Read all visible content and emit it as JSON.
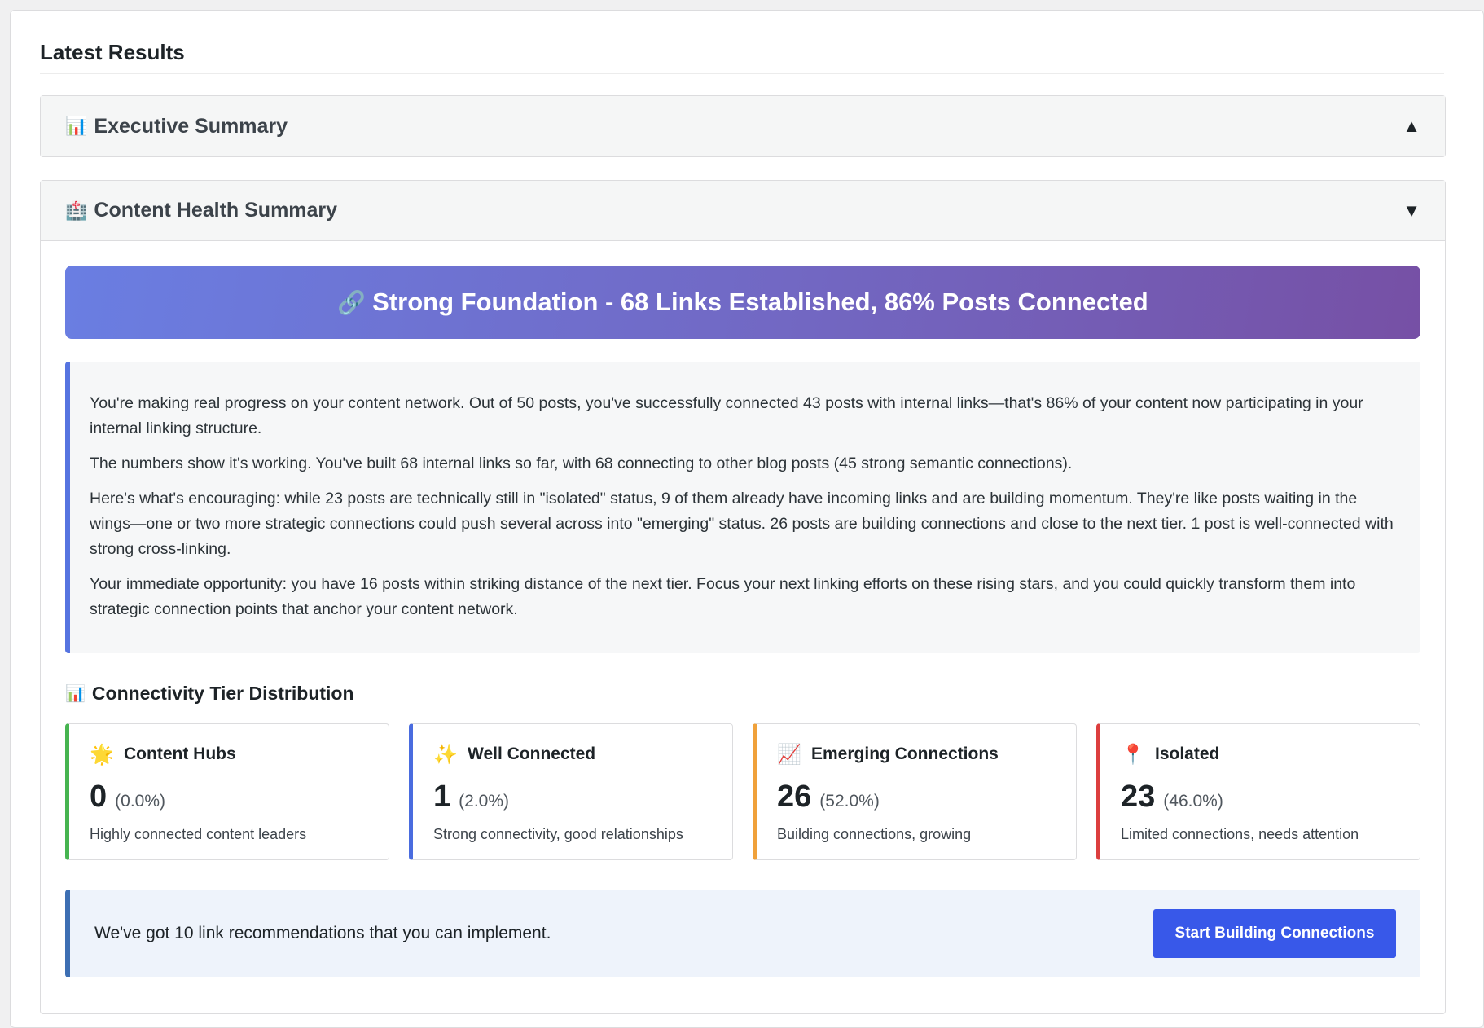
{
  "panel": {
    "title": "Latest Results"
  },
  "executive_summary": {
    "icon": "📊",
    "title": "Executive Summary",
    "toggle": "▲"
  },
  "content_health": {
    "icon": "🏥",
    "title": "Content Health Summary",
    "toggle": "▼",
    "hero": {
      "icon": "🔗",
      "text": "Strong Foundation - 68 Links Established, 86% Posts Connected"
    },
    "paragraphs": [
      "You're making real progress on your content network. Out of 50 posts, you've successfully connected 43 posts with internal links—that's 86% of your content now participating in your internal linking structure.",
      "The numbers show it's working. You've built 68 internal links so far, with 68 connecting to other blog posts (45 strong semantic connections).",
      "Here's what's encouraging: while 23 posts are technically still in \"isolated\" status, 9 of them already have incoming links and are building momentum. They're like posts waiting in the wings—one or two more strategic connections could push several across into \"emerging\" status. 26 posts are building connections and close to the next tier. 1 post is well-connected with strong cross-linking.",
      "Your immediate opportunity: you have 16 posts within striking distance of the next tier. Focus your next linking efforts on these rising stars, and you could quickly transform them into strategic connection points that anchor your content network."
    ],
    "distribution": {
      "icon": "📊",
      "title": "Connectivity Tier Distribution",
      "tiers": [
        {
          "icon": "🌟",
          "label": "Content Hubs",
          "count": "0",
          "percent": "(0.0%)",
          "description": "Highly connected content leaders",
          "color": "#46b450"
        },
        {
          "icon": "✨",
          "label": "Well Connected",
          "count": "1",
          "percent": "(2.0%)",
          "description": "Strong connectivity, good relationships",
          "color": "#4a6cdf"
        },
        {
          "icon": "📈",
          "label": "Emerging Connections",
          "count": "26",
          "percent": "(52.0%)",
          "description": "Building connections, growing",
          "color": "#f0a13a"
        },
        {
          "icon": "📍",
          "label": "Isolated",
          "count": "23",
          "percent": "(46.0%)",
          "description": "Limited connections, needs attention",
          "color": "#dc3e3e"
        }
      ]
    },
    "cta": {
      "text": "We've got 10 link recommendations that you can implement.",
      "button_label": "Start Building Connections"
    }
  }
}
